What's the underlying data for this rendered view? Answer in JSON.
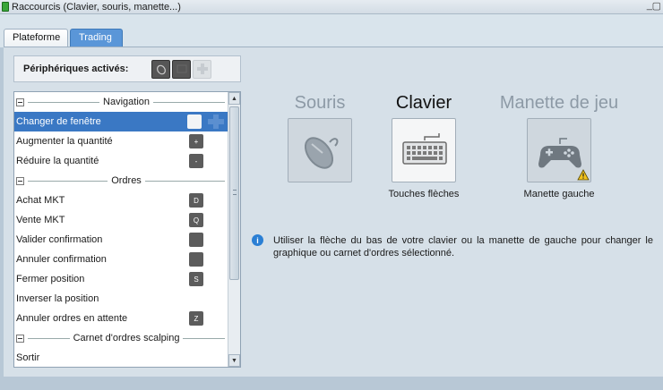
{
  "window": {
    "title": "Raccourcis (Clavier, souris, manette...)",
    "minimize_glyph": "_",
    "close_glyph": "▢"
  },
  "tabs": [
    {
      "label": "Plateforme",
      "active": false
    },
    {
      "label": "Trading",
      "active": true
    }
  ],
  "peripherals": {
    "label": "Périphériques activés:",
    "icons": [
      {
        "name": "mouse-icon",
        "enabled": true
      },
      {
        "name": "keyboard-icon",
        "enabled": true
      },
      {
        "name": "dpad-icon",
        "enabled": false
      }
    ]
  },
  "shortcuts": {
    "groups": [
      {
        "title": "Navigation",
        "items": [
          {
            "label": "Changer de fenêtre",
            "key": "",
            "selected": true,
            "dpad": true
          },
          {
            "label": "Augmenter la quantité",
            "key": "+"
          },
          {
            "label": "Réduire la quantité",
            "key": "-"
          }
        ]
      },
      {
        "title": "Ordres",
        "items": [
          {
            "label": "Achat MKT",
            "key": "D"
          },
          {
            "label": "Vente MKT",
            "key": "Q"
          },
          {
            "label": "Valider confirmation",
            "key": ""
          },
          {
            "label": "Annuler confirmation",
            "key": ""
          },
          {
            "label": "Fermer position",
            "key": "S"
          },
          {
            "label": "Inverser la position",
            "key": null
          },
          {
            "label": "Annuler ordres en attente",
            "key": "Z"
          }
        ]
      },
      {
        "title": "Carnet d'ordres scalping",
        "items": [
          {
            "label": "Sortir",
            "key": null
          }
        ]
      }
    ]
  },
  "devices": {
    "mouse": {
      "name": "Souris",
      "sub": ""
    },
    "keyboard": {
      "name": "Clavier",
      "sub": "Touches flèches"
    },
    "gamepad": {
      "name": "Manette de jeu",
      "sub": "Manette gauche"
    }
  },
  "info": {
    "icon": "info-icon",
    "text": "Utiliser la flèche du bas de votre clavier ou la manette de gauche pour changer le graphique ou carnet d'ordres sélectionné."
  },
  "colors": {
    "selection": "#3a78c4",
    "active_tab": "#5a96d8",
    "info_icon": "#2b7fd4",
    "warning": "#f2c21b"
  }
}
